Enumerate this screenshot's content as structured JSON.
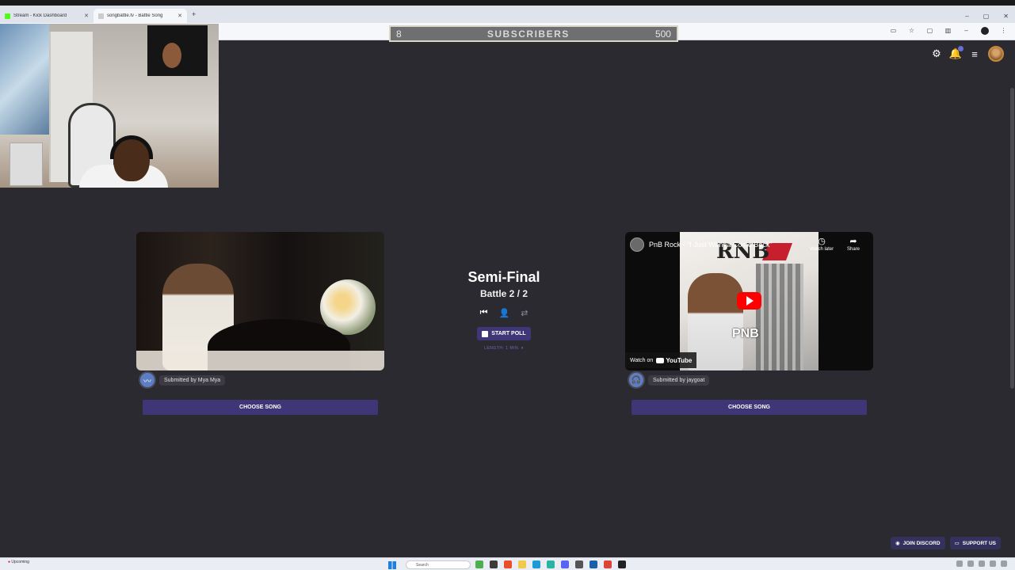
{
  "browser": {
    "tabs": [
      {
        "label": "Stream - Kick Dashboard",
        "icon": "kick-icon",
        "color": "#53fc18"
      },
      {
        "label": "songbattle.tv - Battle Song",
        "icon": "site-icon",
        "color": "#cccccc"
      }
    ],
    "new_tab": "+",
    "controls": [
      "–",
      "▢",
      "✕"
    ]
  },
  "subscribers": {
    "current": "8",
    "label": "SUBSCRIBERS",
    "goal": "500"
  },
  "battle": {
    "round": "Semi-Final",
    "counter": "Battle 2 / 2",
    "start_poll": "START POLL",
    "length": "LENGTH: 1 MIN. ▾"
  },
  "left_song": {
    "submitted_by": "Submitted by Mya Mya",
    "choose_label": "CHOOSE SONG"
  },
  "right_song": {
    "video_title": "PnB Rock - \"I Just Wanna Come Back\"",
    "cover_text": "RNB",
    "cover_sub": "PNB",
    "watch_later": "Watch later",
    "share": "Share",
    "watch_on": "Watch on",
    "youtube": "YouTube",
    "submitted_by": "Submitted by jaygoat",
    "choose_label": "CHOOSE SONG"
  },
  "footer": {
    "discord": "JOIN DISCORD",
    "support": "SUPPORT US"
  },
  "taskbar": {
    "left_line1": "Upcoming",
    "search_placeholder": "Search"
  },
  "colors": {
    "background": "#2b2a31",
    "accent": "#3f3678",
    "youtube_red": "#ff0000"
  }
}
